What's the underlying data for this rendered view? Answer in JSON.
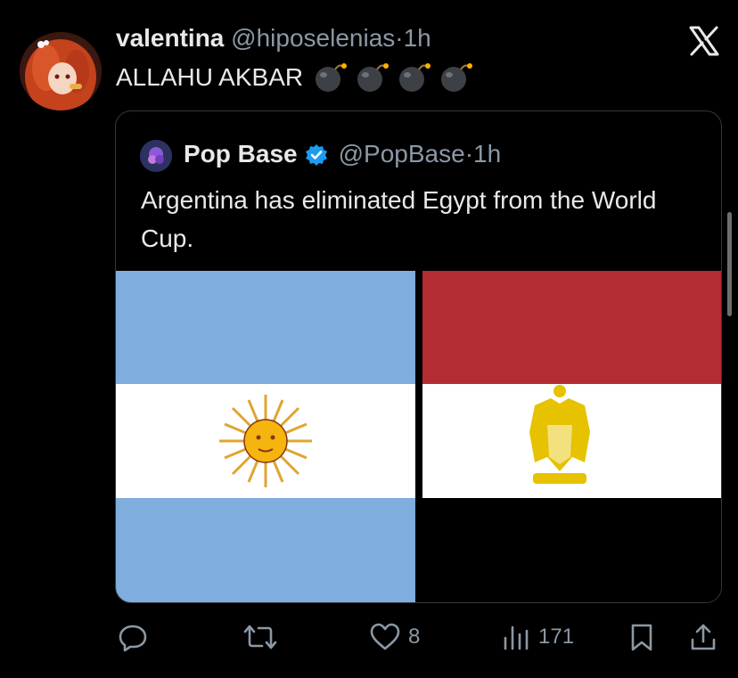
{
  "tweet": {
    "display_name": "valentina",
    "handle": "@hiposelenias",
    "separator": "·",
    "time": "1h",
    "text": "ALLAHU AKBAR",
    "emoji": [
      "bomb-icon",
      "bomb-icon",
      "bomb-icon",
      "bomb-icon"
    ]
  },
  "quote": {
    "display_name": "Pop Base",
    "handle": "@PopBase",
    "separator": "·",
    "time": "1h",
    "text": "Argentina has eliminated Egypt from the World Cup.",
    "verified": true,
    "media": {
      "left_image": "argentina-flag",
      "right_image": "egypt-flag"
    }
  },
  "actions": {
    "reply": {
      "icon": "reply-icon",
      "count": ""
    },
    "retweet": {
      "icon": "retweet-icon",
      "count": ""
    },
    "like": {
      "icon": "heart-icon",
      "count": "8"
    },
    "views": {
      "icon": "views-icon",
      "count": "171"
    },
    "bookmark": {
      "icon": "bookmark-icon"
    },
    "share": {
      "icon": "share-icon"
    }
  },
  "colors": {
    "background": "#000000",
    "text": "#e7e9ea",
    "secondary": "#8b98a5",
    "verified": "#1d9bf0",
    "argentina_blue": "#7fadde",
    "egypt_red": "#b42b33",
    "emblem_gold": "#e6c200"
  }
}
